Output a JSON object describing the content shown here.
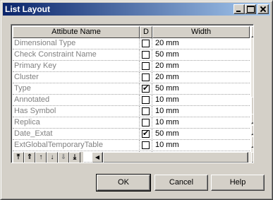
{
  "window": {
    "title": "List Layout"
  },
  "grid": {
    "headers": {
      "name": "Attibute Name",
      "d": "D",
      "width": "Width"
    },
    "rows": [
      {
        "name": "Dimensional Type",
        "checked": false,
        "width": "20 mm"
      },
      {
        "name": "Check Constraint Name",
        "checked": false,
        "width": "50 mm"
      },
      {
        "name": "Primary Key",
        "checked": false,
        "width": "20 mm"
      },
      {
        "name": "Cluster",
        "checked": false,
        "width": "20 mm"
      },
      {
        "name": "Type",
        "checked": true,
        "width": "50 mm"
      },
      {
        "name": "Annotated",
        "checked": false,
        "width": "10 mm"
      },
      {
        "name": "Has Symbol",
        "checked": false,
        "width": "10 mm"
      },
      {
        "name": "Replica",
        "checked": false,
        "width": "10 mm"
      },
      {
        "name": "Date_Extat",
        "checked": true,
        "width": "50 mm"
      },
      {
        "name": "ExtGlobalTemporaryTable",
        "checked": false,
        "width": "10 mm"
      },
      {
        "name": "",
        "checked": false,
        "width": ""
      }
    ]
  },
  "toolbar": {
    "icons": [
      "move-to-top-icon",
      "move-page-up-icon",
      "move-up-icon",
      "move-down-icon",
      "move-page-down-icon",
      "move-to-bottom-icon"
    ]
  },
  "buttons": {
    "ok": "OK",
    "cancel": "Cancel",
    "help": "Help"
  },
  "check_mark": "✔"
}
